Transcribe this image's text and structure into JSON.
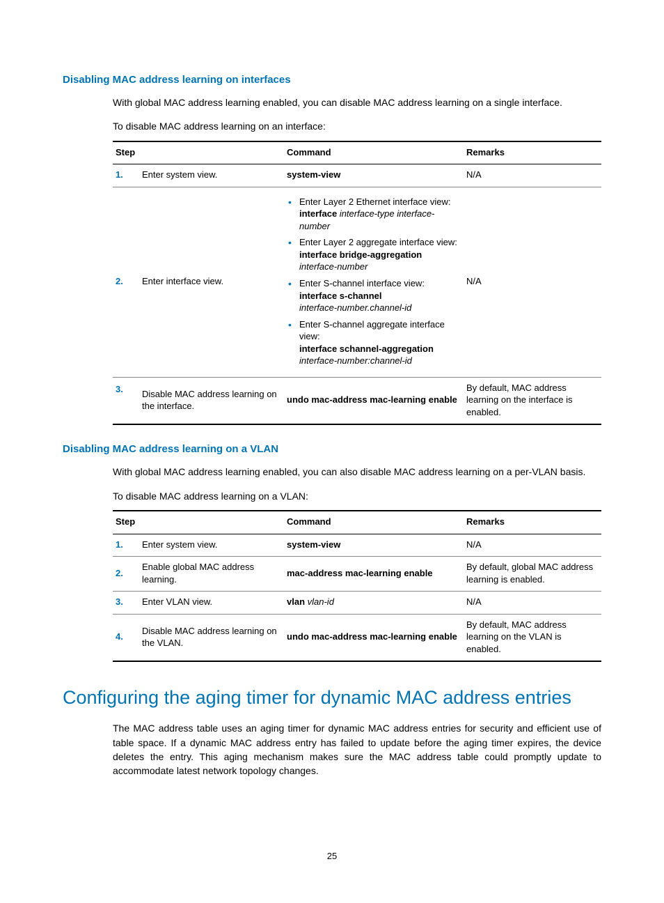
{
  "section1": {
    "heading": "Disabling MAC address learning on interfaces",
    "intro1": "With global MAC address learning enabled, you can disable MAC address learning on a single interface.",
    "intro2": "To disable MAC address learning on an interface:",
    "tableHeaders": {
      "step": "Step",
      "command": "Command",
      "remarks": "Remarks"
    },
    "rows": [
      {
        "num": "1.",
        "desc": "Enter system view.",
        "cmd_bold": "system-view",
        "remarks": "N/A"
      },
      {
        "num": "2.",
        "desc": "Enter interface view.",
        "bullets": [
          {
            "lead": "Enter Layer 2 Ethernet interface view:",
            "bold": "interface",
            "ital_after_bold": " interface-type interface-number"
          },
          {
            "lead": "Enter Layer 2 aggregate interface view:",
            "bold": "interface bridge-aggregation",
            "ital_after_bold": " interface-number"
          },
          {
            "lead": "Enter S-channel interface view:",
            "bold": "interface s-channel",
            "ital_after_bold": " interface-number.channel-id"
          },
          {
            "lead": "Enter S-channel aggregate interface view:",
            "bold": "interface schannel-aggregation",
            "ital_after_bold": " interface-number:channel-id"
          }
        ],
        "remarks": "N/A"
      },
      {
        "num": "3.",
        "desc": "Disable MAC address learning on the interface.",
        "cmd_bold": "undo mac-address mac-learning enable",
        "remarks": "By default, MAC address learning on the interface is enabled."
      }
    ]
  },
  "section2": {
    "heading": "Disabling MAC address learning on a VLAN",
    "intro1": "With global MAC address learning enabled, you can also disable MAC address learning on a per-VLAN basis.",
    "intro2": "To disable MAC address learning on a VLAN:",
    "tableHeaders": {
      "step": "Step",
      "command": "Command",
      "remarks": "Remarks"
    },
    "rows": [
      {
        "num": "1.",
        "desc": "Enter system view.",
        "cmd_bold": "system-view",
        "remarks": "N/A"
      },
      {
        "num": "2.",
        "desc": "Enable global MAC address learning.",
        "cmd_bold": "mac-address mac-learning enable",
        "remarks": "By default, global MAC address learning is enabled."
      },
      {
        "num": "3.",
        "desc": "Enter VLAN view.",
        "cmd_bold": "vlan",
        "cmd_ital": " vlan-id",
        "remarks": "N/A"
      },
      {
        "num": "4.",
        "desc": "Disable MAC address learning on the VLAN.",
        "cmd_bold": "undo mac-address mac-learning enable",
        "remarks": "By default, MAC address learning on the VLAN is enabled."
      }
    ]
  },
  "section3": {
    "heading": "Configuring the aging timer for dynamic MAC address entries",
    "body": "The MAC address table uses an aging timer for dynamic MAC address entries for security and efficient use of table space. If a dynamic MAC address entry has failed to update before the aging timer expires, the device deletes the entry. This aging mechanism makes sure the MAC address table could promptly update to accommodate latest network topology changes."
  },
  "pageNumber": "25"
}
